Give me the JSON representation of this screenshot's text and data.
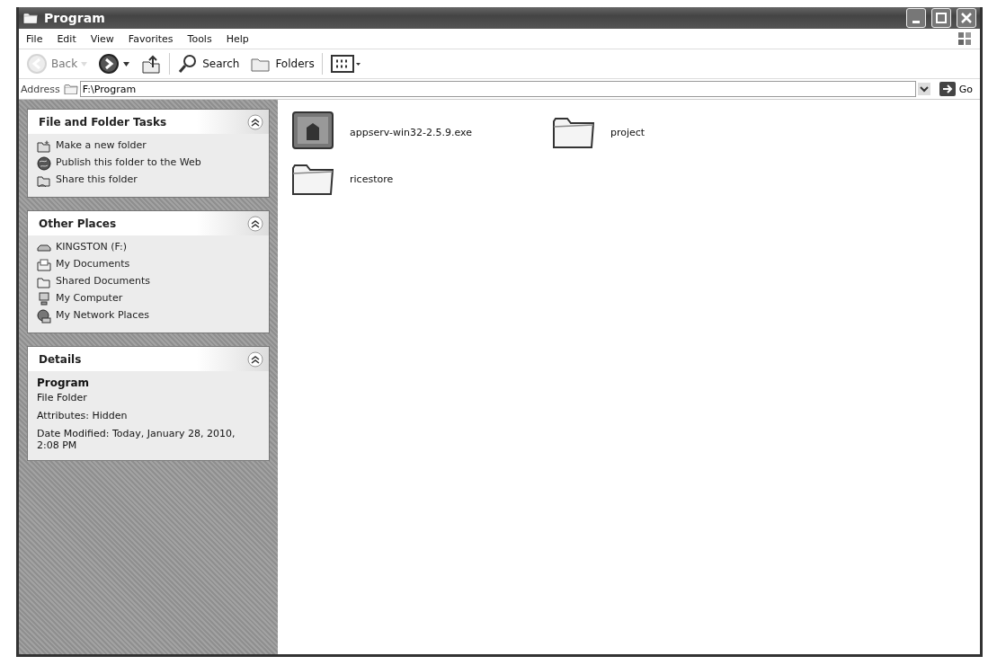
{
  "window": {
    "title": "Program"
  },
  "menu": [
    "File",
    "Edit",
    "View",
    "Favorites",
    "Tools",
    "Help"
  ],
  "toolbar": [
    {
      "kind": "back",
      "label": "Back",
      "disabled": true
    },
    {
      "kind": "forward",
      "disabled": false
    },
    {
      "kind": "up",
      "disabled": false
    },
    {
      "kind": "search",
      "label": "Search",
      "disabled": false
    },
    {
      "kind": "folders",
      "label": "Folders",
      "disabled": false
    },
    {
      "kind": "views",
      "disabled": false
    }
  ],
  "address": {
    "label": "Address",
    "value": "F:\\Program",
    "go": "Go"
  },
  "panels": [
    {
      "kind": "links",
      "title": "File and Folder Tasks",
      "items": [
        {
          "kind": "new-folder",
          "label": "Make a new folder"
        },
        {
          "kind": "publish",
          "label": "Publish this folder to the Web"
        },
        {
          "kind": "share",
          "label": "Share this folder"
        }
      ]
    },
    {
      "kind": "links",
      "title": "Other Places",
      "items": [
        {
          "kind": "drive",
          "label": "KINGSTON (F:)"
        },
        {
          "kind": "documents",
          "label": "My Documents"
        },
        {
          "kind": "folder",
          "label": "Shared Documents"
        },
        {
          "kind": "computer",
          "label": "My Computer"
        },
        {
          "kind": "network",
          "label": "My Network Places"
        }
      ]
    },
    {
      "kind": "details",
      "title": "Details",
      "name": "Program",
      "lines": [
        "File Folder",
        "Attributes: Hidden",
        "Date Modified: Today, January 28, 2010, 2:08 PM"
      ]
    }
  ],
  "files": [
    {
      "kind": "exe",
      "name": "appserv-win32-2.5.9.exe"
    },
    {
      "kind": "folder",
      "name": "project"
    },
    {
      "kind": "folder",
      "name": "ricestore"
    }
  ]
}
